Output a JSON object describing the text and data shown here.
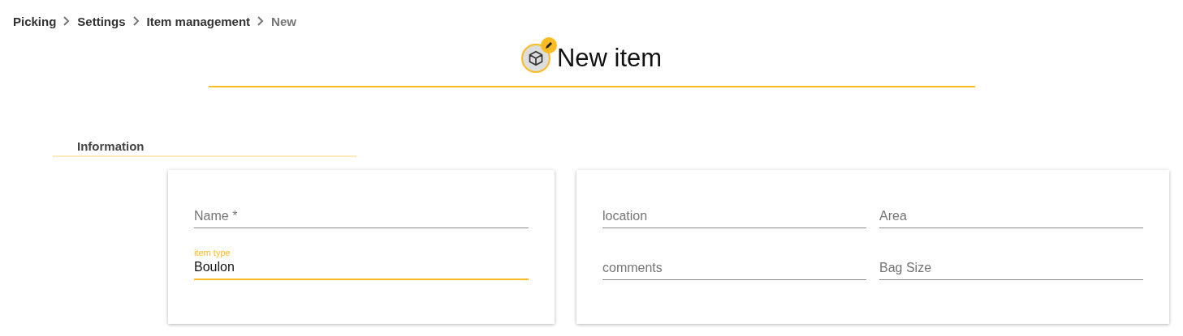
{
  "breadcrumb": [
    {
      "label": "Picking",
      "current": false
    },
    {
      "label": "Settings",
      "current": false
    },
    {
      "label": "Item management",
      "current": false
    },
    {
      "label": "New",
      "current": true
    }
  ],
  "header": {
    "title": "New item"
  },
  "section": {
    "title": "Information"
  },
  "cards": [
    {
      "fields": [
        {
          "placeholder": "Name *",
          "focused": false
        },
        {
          "label": "item type",
          "value": "Boulon",
          "focused": true
        }
      ]
    },
    {
      "fields": [
        {
          "placeholder": "location",
          "focused": false
        },
        {
          "placeholder": "Area",
          "focused": false
        },
        {
          "placeholder": "comments",
          "focused": false
        },
        {
          "placeholder": "Bag Size",
          "focused": false
        }
      ]
    }
  ]
}
